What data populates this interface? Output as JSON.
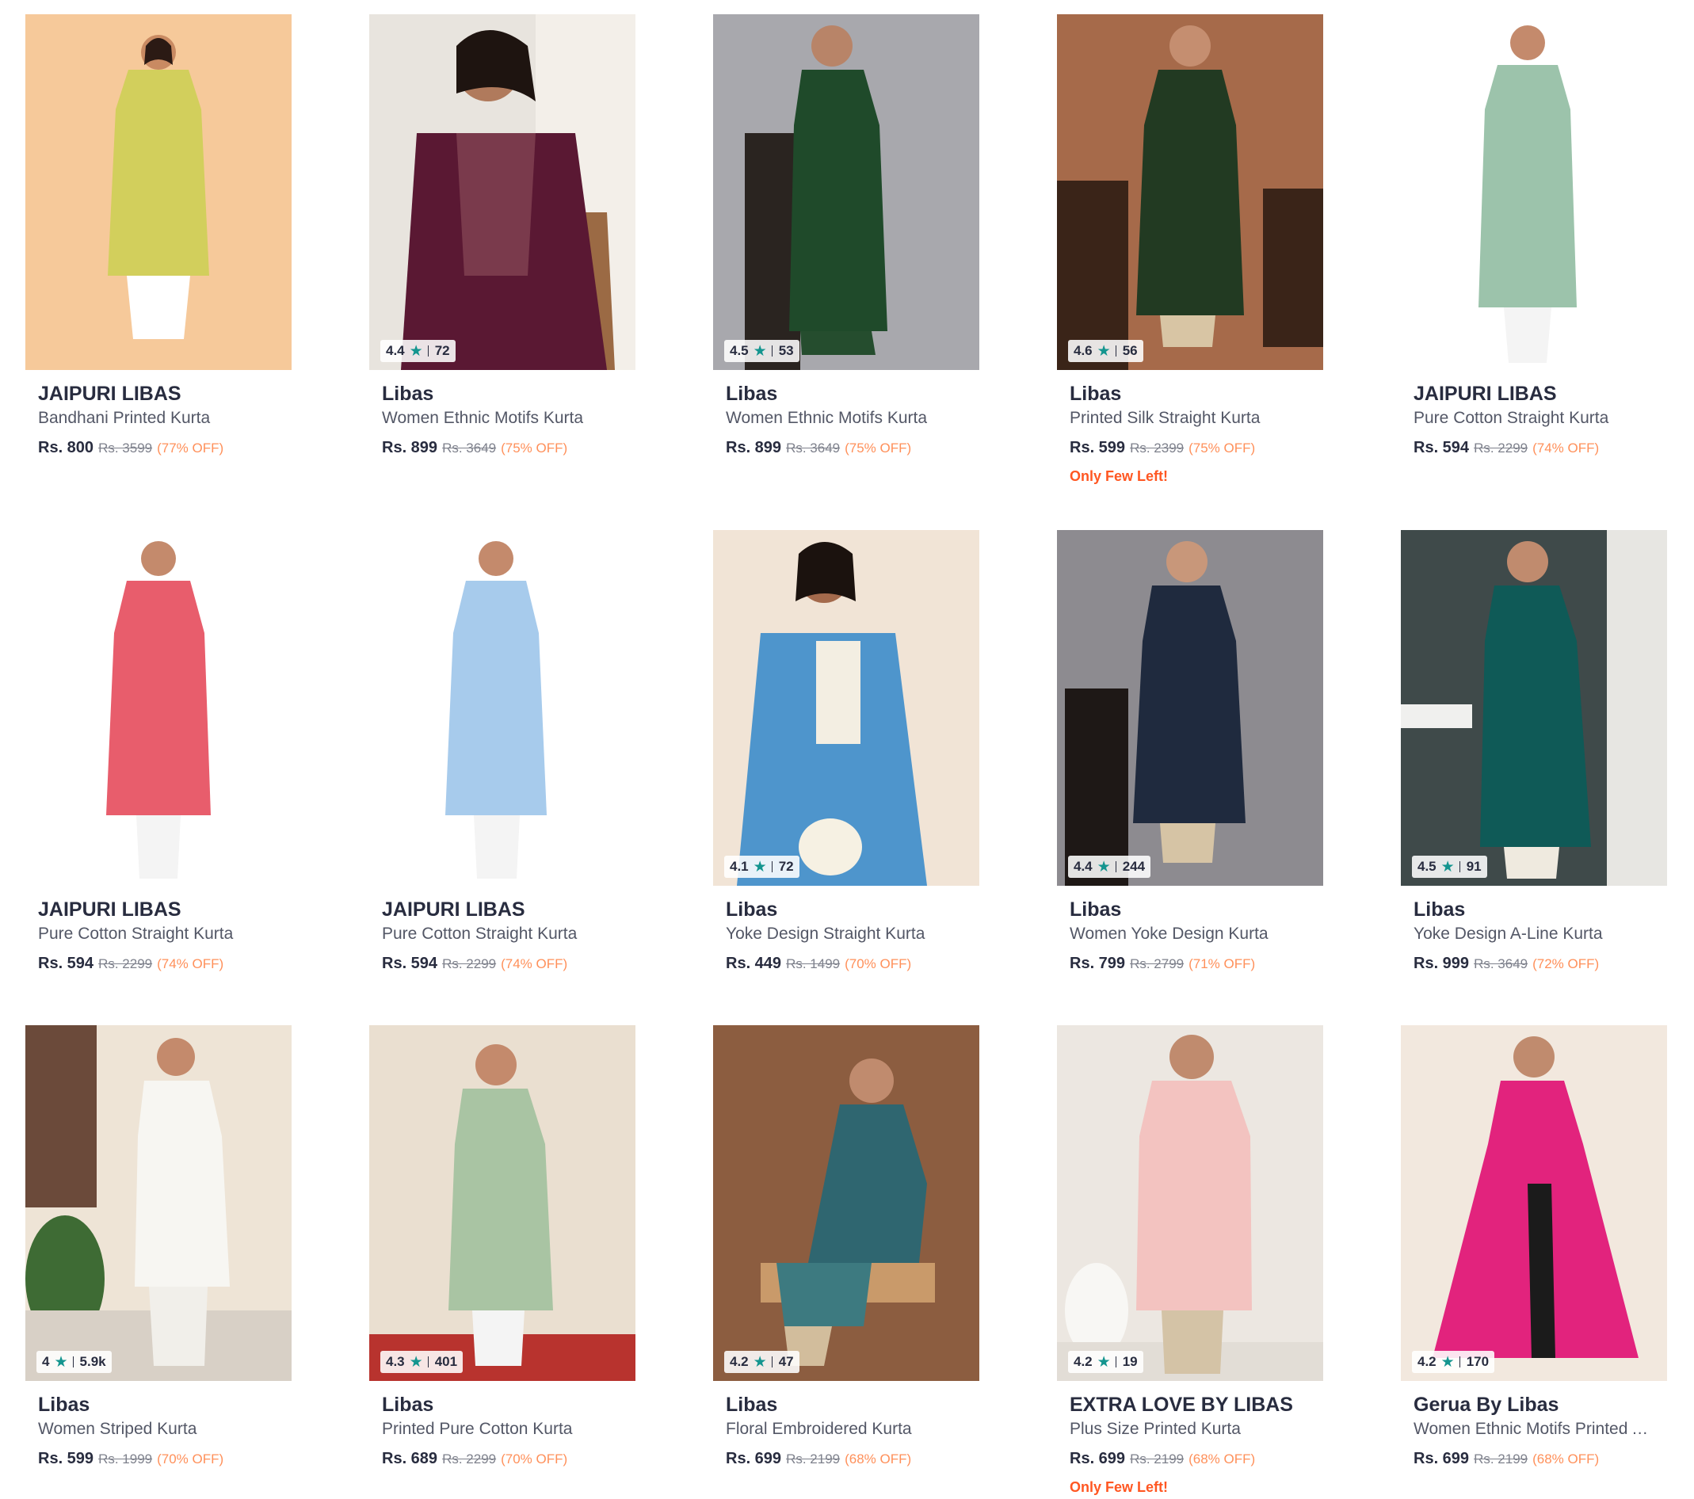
{
  "colors": {
    "rating_star": "#14958f",
    "discount": "#ff905a",
    "few_left": "#ff5722"
  },
  "products": [
    {
      "brand": "JAIPURI LIBAS",
      "name": "Bandhani Printed Kurta",
      "price": "Rs. 800",
      "mrp": "Rs. 3599",
      "discount": "(77% OFF)",
      "rating": "",
      "count": "",
      "stock": ""
    },
    {
      "brand": "Libas",
      "name": "Women Ethnic Motifs Kurta",
      "price": "Rs. 899",
      "mrp": "Rs. 3649",
      "discount": "(75% OFF)",
      "rating": "4.4",
      "count": "72",
      "stock": ""
    },
    {
      "brand": "Libas",
      "name": "Women Ethnic Motifs Kurta",
      "price": "Rs. 899",
      "mrp": "Rs. 3649",
      "discount": "(75% OFF)",
      "rating": "4.5",
      "count": "53",
      "stock": ""
    },
    {
      "brand": "Libas",
      "name": "Printed Silk Straight Kurta",
      "price": "Rs. 599",
      "mrp": "Rs. 2399",
      "discount": "(75% OFF)",
      "rating": "4.6",
      "count": "56",
      "stock": "Only Few Left!"
    },
    {
      "brand": "JAIPURI LIBAS",
      "name": "Pure Cotton Straight Kurta",
      "price": "Rs. 594",
      "mrp": "Rs. 2299",
      "discount": "(74% OFF)",
      "rating": "",
      "count": "",
      "stock": ""
    },
    {
      "brand": "JAIPURI LIBAS",
      "name": "Pure Cotton Straight Kurta",
      "price": "Rs. 594",
      "mrp": "Rs. 2299",
      "discount": "(74% OFF)",
      "rating": "",
      "count": "",
      "stock": ""
    },
    {
      "brand": "JAIPURI LIBAS",
      "name": "Pure Cotton Straight Kurta",
      "price": "Rs. 594",
      "mrp": "Rs. 2299",
      "discount": "(74% OFF)",
      "rating": "",
      "count": "",
      "stock": ""
    },
    {
      "brand": "Libas",
      "name": "Yoke Design Straight Kurta",
      "price": "Rs. 449",
      "mrp": "Rs. 1499",
      "discount": "(70% OFF)",
      "rating": "4.1",
      "count": "72",
      "stock": ""
    },
    {
      "brand": "Libas",
      "name": "Women Yoke Design Kurta",
      "price": "Rs. 799",
      "mrp": "Rs. 2799",
      "discount": "(71% OFF)",
      "rating": "4.4",
      "count": "244",
      "stock": ""
    },
    {
      "brand": "Libas",
      "name": "Yoke Design A-Line Kurta",
      "price": "Rs. 999",
      "mrp": "Rs. 3649",
      "discount": "(72% OFF)",
      "rating": "4.5",
      "count": "91",
      "stock": ""
    },
    {
      "brand": "Libas",
      "name": "Women Striped Kurta",
      "price": "Rs. 599",
      "mrp": "Rs. 1999",
      "discount": "(70% OFF)",
      "rating": "4",
      "count": "5.9k",
      "stock": ""
    },
    {
      "brand": "Libas",
      "name": "Printed Pure Cotton Kurta",
      "price": "Rs. 689",
      "mrp": "Rs. 2299",
      "discount": "(70% OFF)",
      "rating": "4.3",
      "count": "401",
      "stock": ""
    },
    {
      "brand": "Libas",
      "name": "Floral Embroidered Kurta",
      "price": "Rs. 699",
      "mrp": "Rs. 2199",
      "discount": "(68% OFF)",
      "rating": "4.2",
      "count": "47",
      "stock": ""
    },
    {
      "brand": "EXTRA LOVE BY LIBAS",
      "name": "Plus Size Printed Kurta",
      "price": "Rs. 699",
      "mrp": "Rs. 2199",
      "discount": "(68% OFF)",
      "rating": "4.2",
      "count": "19",
      "stock": "Only Few Left!"
    },
    {
      "brand": "Gerua By Libas",
      "name": "Women Ethnic Motifs Printed A-Line Kurta",
      "price": "Rs. 699",
      "mrp": "Rs. 2199",
      "discount": "(68% OFF)",
      "rating": "4.2",
      "count": "170",
      "stock": ""
    }
  ]
}
